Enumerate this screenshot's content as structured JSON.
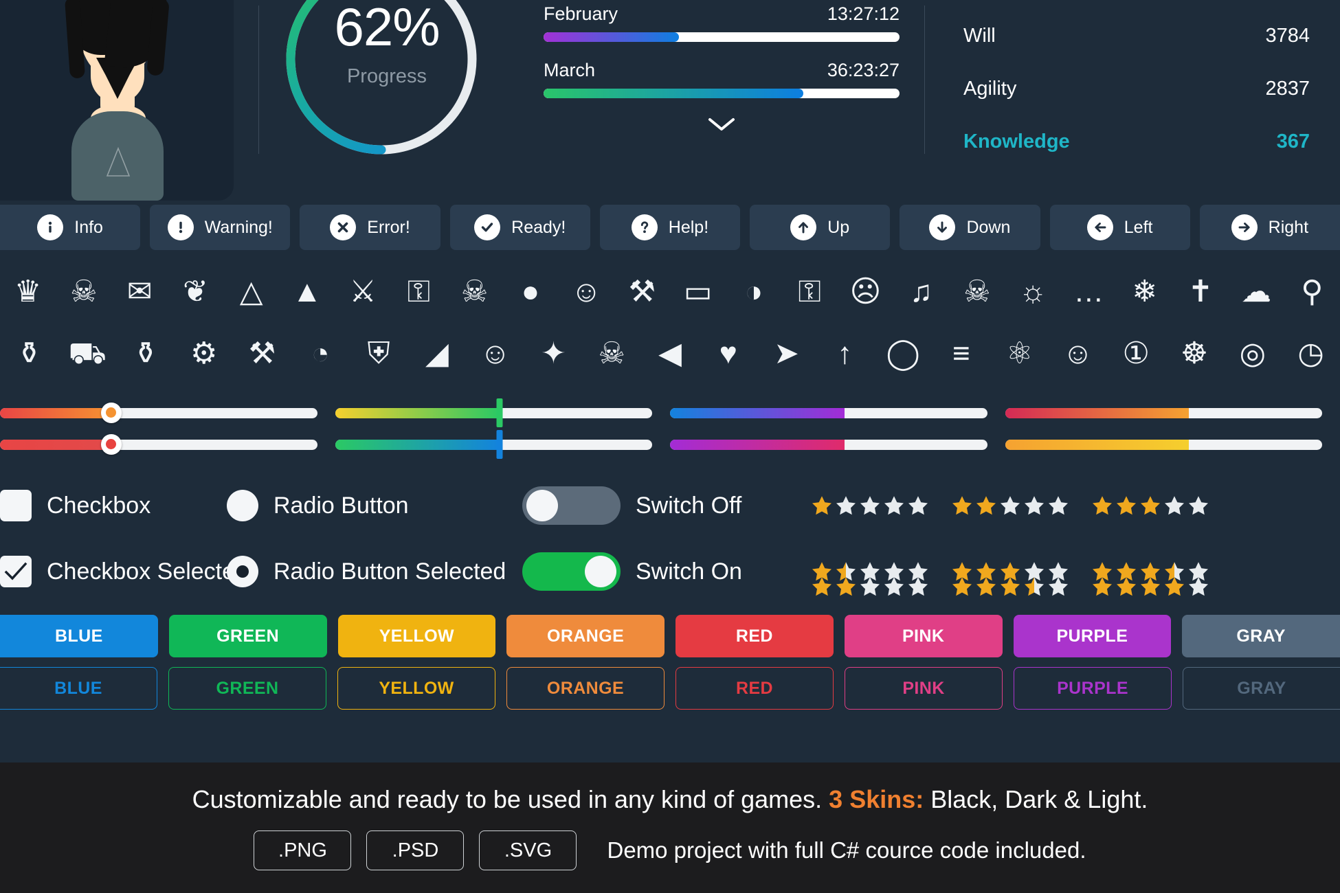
{
  "dashboard": {
    "avatar_name": "avatar-portrait",
    "progress": {
      "value": 62,
      "display": "62%",
      "label": "Progress"
    },
    "months": [
      {
        "name": "February",
        "time": "13:27:12",
        "percent": 38,
        "from": "#a231d6",
        "to": "#0e7fe0"
      },
      {
        "name": "March",
        "time": "36:23:27",
        "percent": 73,
        "from": "#2ac56a",
        "to": "#0d7ee0"
      }
    ],
    "expand_icon": "chevron-down-icon",
    "stats": [
      {
        "name": "Will",
        "value": "3784",
        "highlight": false
      },
      {
        "name": "Agility",
        "value": "2837",
        "highlight": false
      },
      {
        "name": "Knowledge",
        "value": "367",
        "highlight": true
      }
    ],
    "accent": "#1fb6c7"
  },
  "buttons": [
    {
      "label": "Info",
      "icon": "info-icon"
    },
    {
      "label": "Warning!",
      "icon": "warning-icon"
    },
    {
      "label": "Error!",
      "icon": "error-icon"
    },
    {
      "label": "Ready!",
      "icon": "check-icon"
    },
    {
      "label": "Help!",
      "icon": "question-icon"
    },
    {
      "label": "Up",
      "icon": "arrow-up-icon"
    },
    {
      "label": "Down",
      "icon": "arrow-down-icon"
    },
    {
      "label": "Left",
      "icon": "arrow-left-icon"
    },
    {
      "label": "Right",
      "icon": "arrow-right-icon"
    }
  ],
  "icon_rows": [
    [
      "crown-icon",
      "skull-icon",
      "envelope-icon",
      "leaves-icon",
      "wizard-hat-icon",
      "fire-icon",
      "crossed-swords-icon",
      "key-icon",
      "horned-skull-icon",
      "bomb-icon",
      "user-icon",
      "axe-icon",
      "briefcase-icon",
      "viking-helmet-icon",
      "lock-icon",
      "hooded-figure-icon",
      "headphones-icon",
      "skull-alt-icon",
      "lightbulb-icon",
      "chat-bubble-icon",
      "snowflake-icon",
      "grave-icon",
      "rain-cloud-icon",
      "search-icon"
    ],
    [
      "trophy-star-icon",
      "shopping-cart-icon",
      "trophy-icon",
      "gear-icon",
      "pickaxe-icon",
      "ufo-icon",
      "shield-icon",
      "pistol-icon",
      "add-user-icon",
      "magic-wand-icon",
      "skull-cross-icon",
      "speaker-icon",
      "heart-icon",
      "wing-icon",
      "rocket-icon",
      "planet-icon",
      "dumbbell-icon",
      "praying-hands-icon",
      "angel-icon",
      "medal-first-icon",
      "medal-icon",
      "coins-icon",
      "clock-icon"
    ]
  ],
  "sliders": [
    {
      "type": "round-knob",
      "percent": 35,
      "from": "#e84545",
      "to": "#f59331",
      "knob": "#f59331"
    },
    {
      "type": "round-knob",
      "percent": 35,
      "from": "#e84545",
      "to": "#e24a4a",
      "knob": "#e8423f"
    },
    {
      "type": "bar-knob",
      "percent": 52,
      "from": "#f5cf2e",
      "to": "#2bc964",
      "knob": "#2bc964"
    },
    {
      "type": "bar-knob",
      "percent": 52,
      "from": "#2bc964",
      "to": "#1383dd",
      "knob": "#1383dd"
    },
    {
      "type": "plain",
      "percent": 55,
      "from": "#1383dd",
      "to": "#a32cd6"
    },
    {
      "type": "plain",
      "percent": 55,
      "from": "#a32cd6",
      "to": "#e02b6a"
    },
    {
      "type": "plain",
      "percent": 58,
      "from": "#d42a55",
      "to": "#f5a231"
    },
    {
      "type": "plain",
      "percent": 58,
      "from": "#f5a231",
      "to": "#f5cf2e"
    }
  ],
  "controls": {
    "checkbox": {
      "label": "Checkbox",
      "checked": false
    },
    "checkbox_selected": {
      "label": "Checkbox Selected",
      "checked": true
    },
    "radio": {
      "label": "Radio Button",
      "selected": false
    },
    "radio_selected": {
      "label": "Radio Button Selected",
      "selected": true
    },
    "switch_off": {
      "label": "Switch Off",
      "on": false
    },
    "switch_on": {
      "label": "Switch On",
      "on": true
    },
    "star_color": "#f0a81e",
    "star_empty": "#e8ecef",
    "star_max": 5,
    "star_ratings": [
      [
        1,
        2,
        3
      ],
      [
        1.5,
        3,
        3.5
      ],
      [
        2,
        3.5,
        4
      ]
    ]
  },
  "color_buttons": [
    {
      "label": "BLUE",
      "color": "#1287db"
    },
    {
      "label": "GREEN",
      "color": "#10b757"
    },
    {
      "label": "YELLOW",
      "color": "#f0b310"
    },
    {
      "label": "ORANGE",
      "color": "#ef8b3c"
    },
    {
      "label": "RED",
      "color": "#e53b42"
    },
    {
      "label": "PINK",
      "color": "#e03f86"
    },
    {
      "label": "PURPLE",
      "color": "#aa34cc"
    },
    {
      "label": "GRAY",
      "color": "#53687d"
    }
  ],
  "outline_buttons": [
    {
      "label": "BLUE",
      "color": "#1287db"
    },
    {
      "label": "GREEN",
      "color": "#10b757"
    },
    {
      "label": "YELLOW",
      "color": "#f0b310"
    },
    {
      "label": "ORANGE",
      "color": "#ef8b3c"
    },
    {
      "label": "RED",
      "color": "#e53b42"
    },
    {
      "label": "PINK",
      "color": "#e03f86"
    },
    {
      "label": "PURPLE",
      "color": "#aa34cc"
    },
    {
      "label": "GRAY",
      "color": "#53687d"
    }
  ],
  "footer": {
    "tagline_a": "Customizable and ready to be used in any kind of games. ",
    "tagline_b": "3 Skins:",
    "tagline_c": " Black, Dark & Light.",
    "formats": [
      ".PNG",
      ".PSD",
      ".SVG"
    ],
    "demo_text": "Demo project with full C# cource code included.",
    "highlight_color": "#f08030"
  }
}
